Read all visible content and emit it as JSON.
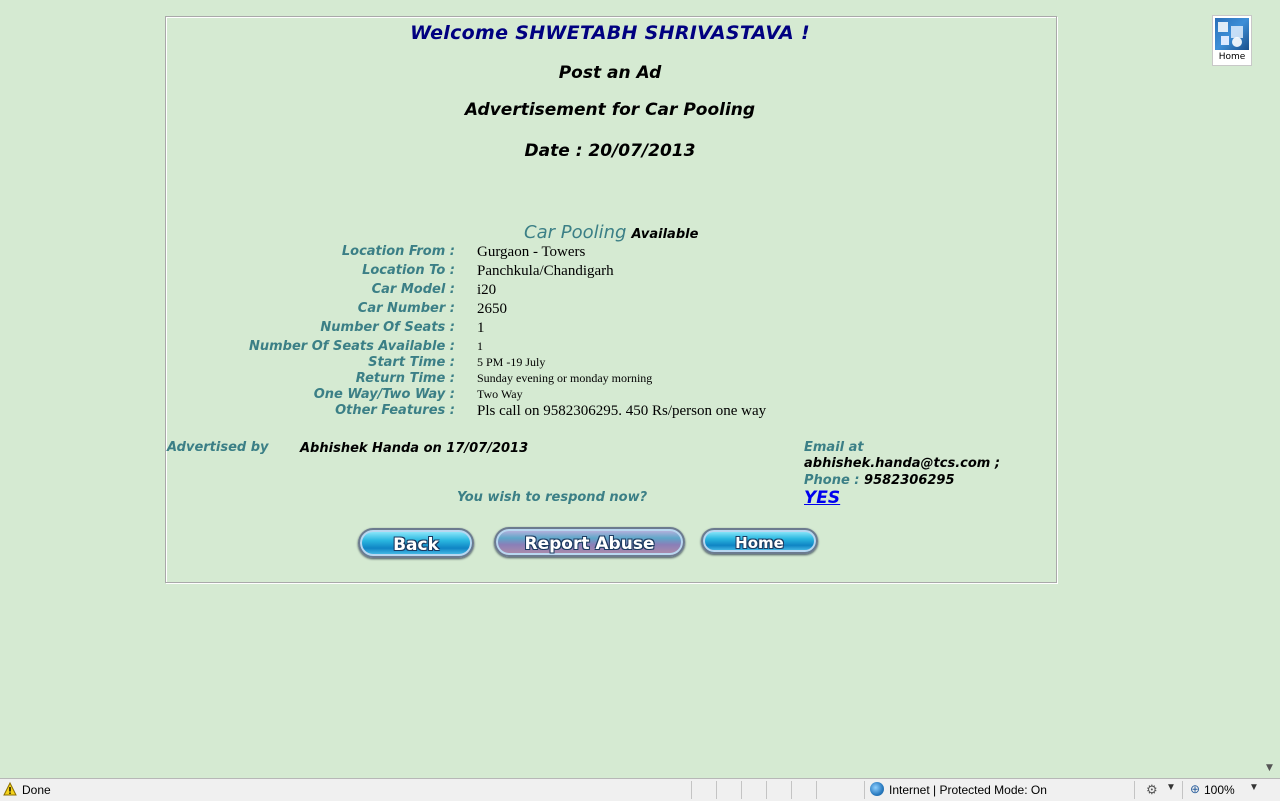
{
  "header": {
    "welcome": "Welcome SHWETABH SHRIVASTAVA !",
    "post_ad": "Post an Ad",
    "adv_title": "Advertisement for Car Pooling",
    "date": "Date : 20/07/2013"
  },
  "corner_link": {
    "label": "Home",
    "icon": "tcs-home-icon"
  },
  "listing": {
    "heading_main": "Car Pooling",
    "heading_sub": "Available",
    "fields": [
      {
        "label": "Location From :",
        "value": "Gurgaon - Towers"
      },
      {
        "label": "Location To :",
        "value": "Panchkula/Chandigarh"
      },
      {
        "label": "Car Model :",
        "value": "i20"
      },
      {
        "label": "Car Number :",
        "value": "2650"
      },
      {
        "label": "Number Of Seats :",
        "value": "1"
      },
      {
        "label": "Number Of Seats Available :",
        "value": "1"
      },
      {
        "label": "Start Time :",
        "value": "5 PM -19 July"
      },
      {
        "label": "Return Time :",
        "value": "Sunday evening or monday morning"
      },
      {
        "label": "One Way/Two Way :",
        "value": "Two Way"
      },
      {
        "label": "Other Features :",
        "value": "Pls call on 9582306295. 450 Rs/person one way"
      }
    ]
  },
  "advertiser": {
    "label": "Advertised by",
    "value": "Abhishek Handa on 17/07/2013"
  },
  "contact": {
    "email_label": "Email at",
    "email_value": "abhishek.handa@tcs.com ;",
    "phone_label": "Phone :",
    "phone_value": "9582306295",
    "respond_prompt": "You wish to respond now?",
    "yes_label": "YES"
  },
  "buttons": {
    "back": "Back",
    "report_abuse": "Report Abuse",
    "home": "Home"
  },
  "statusbar": {
    "status": "Done",
    "zone": "Internet | Protected Mode: On",
    "zoom": "100%"
  },
  "colors": {
    "background": "#d5ead2",
    "label_teal": "#3b7f86",
    "welcome_navy": "#000080",
    "link_blue": "#0000ee"
  }
}
